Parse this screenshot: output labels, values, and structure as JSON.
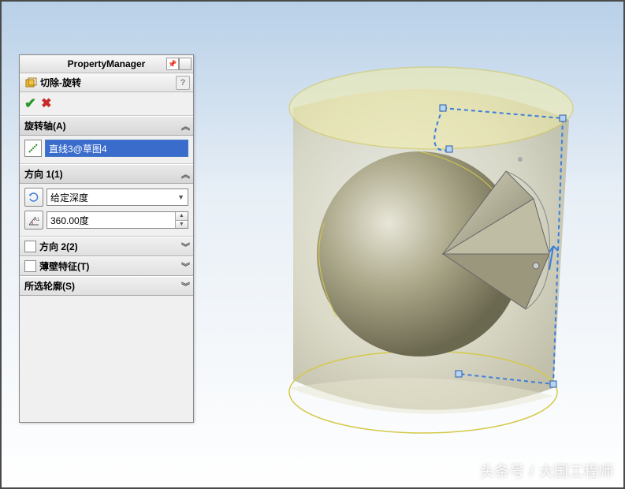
{
  "panel": {
    "title": "PropertyManager",
    "feature_title": "切除-旋转",
    "help": "?",
    "sections": {
      "axis": {
        "label": "旋转轴(A)",
        "value": "直线3@草图4"
      },
      "dir1": {
        "label": "方向 1(1)",
        "dropdown_value": "给定深度",
        "angle_value": "360.00度"
      },
      "dir2": {
        "label": "方向 2(2)"
      },
      "thin": {
        "label": "薄壁特征(T)"
      },
      "selcontour": {
        "label": "所选轮廓(S)"
      }
    }
  },
  "watermark": "头条号 / 大国工程师"
}
